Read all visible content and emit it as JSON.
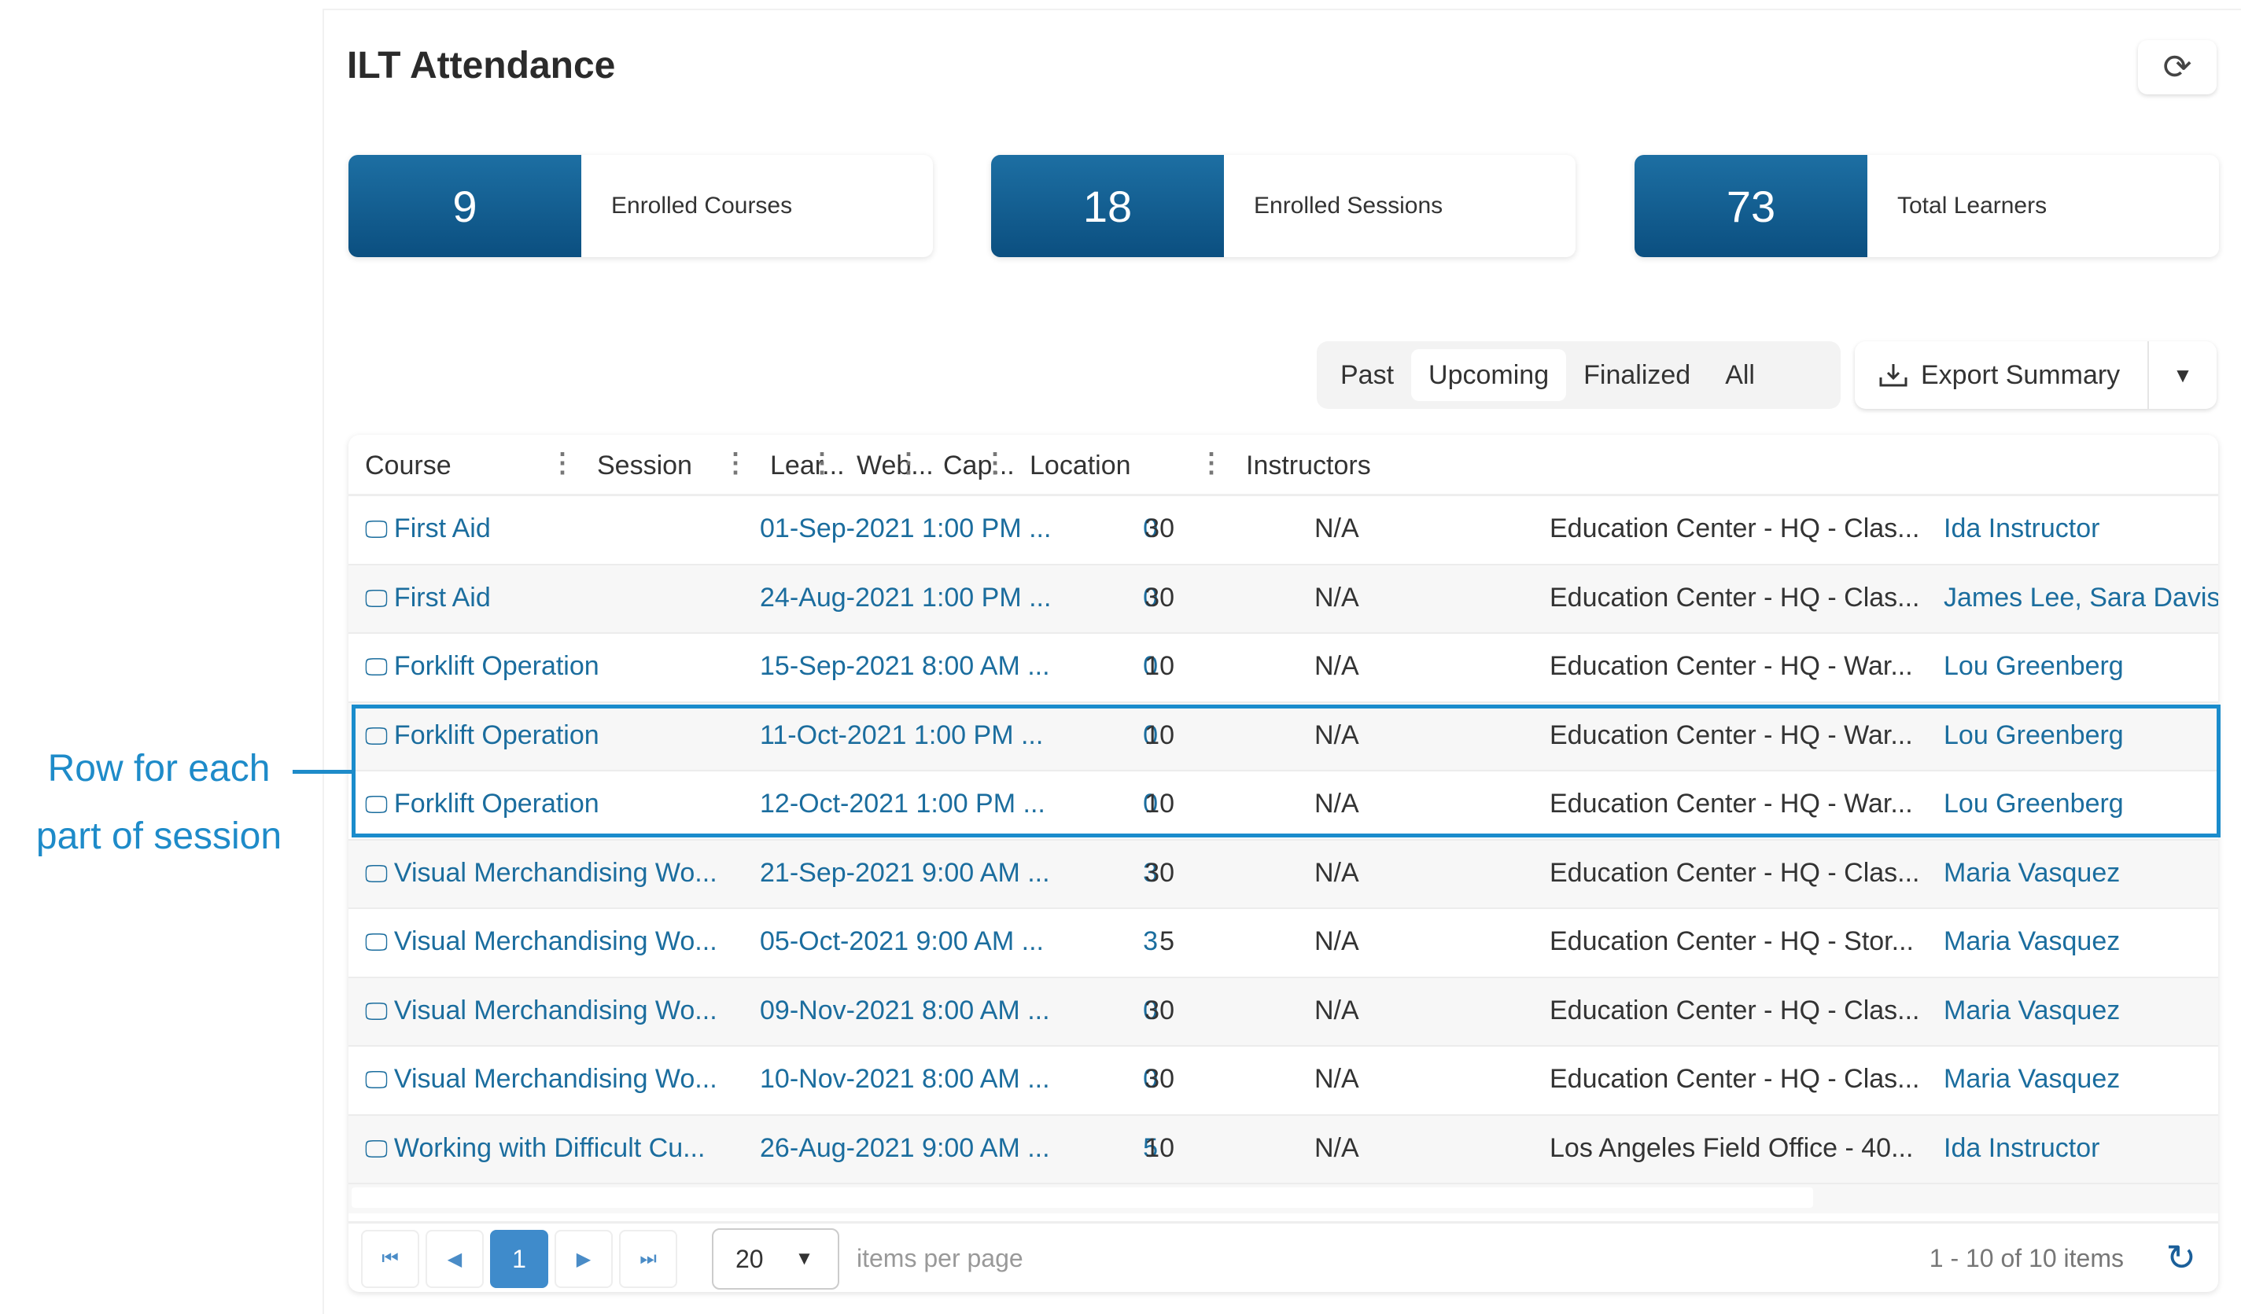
{
  "header": {
    "title": "ILT Attendance"
  },
  "stats": [
    {
      "value": "9",
      "label": "Enrolled Courses"
    },
    {
      "value": "18",
      "label": "Enrolled Sessions"
    },
    {
      "value": "73",
      "label": "Total Learners"
    }
  ],
  "filters": [
    {
      "label": "Past",
      "active": false
    },
    {
      "label": "Upcoming",
      "active": true
    },
    {
      "label": "Finalized",
      "active": false
    },
    {
      "label": "All",
      "active": false
    }
  ],
  "export": {
    "label": "Export Summary"
  },
  "columns": [
    "Course",
    "Session",
    "Lear...",
    "Web...",
    "Cap...",
    "Location",
    "Instructors"
  ],
  "rows": [
    [
      "First Aid",
      "01-Sep-2021 1:00 PM ...",
      "0",
      "N/A",
      "30",
      "Education Center - HQ - Clas...",
      "Ida Instructor"
    ],
    [
      "First Aid",
      "24-Aug-2021 1:00 PM ...",
      "0",
      "N/A",
      "30",
      "Education Center - HQ - Clas...",
      "James Lee, Sara Davis"
    ],
    [
      "Forklift Operation",
      "15-Sep-2021 8:00 AM ...",
      "0",
      "N/A",
      "10",
      "Education Center - HQ - War...",
      "Lou Greenberg"
    ],
    [
      "Forklift Operation",
      "11-Oct-2021 1:00 PM ...",
      "0",
      "N/A",
      "10",
      "Education Center - HQ - War...",
      "Lou Greenberg"
    ],
    [
      "Forklift Operation",
      "12-Oct-2021 1:00 PM ...",
      "0",
      "N/A",
      "10",
      "Education Center - HQ - War...",
      "Lou Greenberg"
    ],
    [
      "Visual Merchandising Wo...",
      "21-Sep-2021 9:00 AM ...",
      "3",
      "N/A",
      "30",
      "Education Center - HQ - Clas...",
      "Maria Vasquez"
    ],
    [
      "Visual Merchandising Wo...",
      "05-Oct-2021 9:00 AM ...",
      "3",
      "N/A",
      "5",
      "Education Center - HQ - Stor...",
      "Maria Vasquez"
    ],
    [
      "Visual Merchandising Wo...",
      "09-Nov-2021 8:00 AM ...",
      "0",
      "N/A",
      "30",
      "Education Center - HQ - Clas...",
      "Maria Vasquez"
    ],
    [
      "Visual Merchandising Wo...",
      "10-Nov-2021 8:00 AM ...",
      "0",
      "N/A",
      "30",
      "Education Center - HQ - Clas...",
      "Maria Vasquez"
    ],
    [
      "Working with Difficult Cu...",
      "26-Aug-2021 9:00 AM ...",
      "5",
      "N/A",
      "10",
      "Los Angeles Field Office - 40...",
      "Ida Instructor"
    ]
  ],
  "pager": {
    "current": "1",
    "page_size": "20",
    "items_per_page_label": "items per page",
    "count": "1 - 10 of 10 items"
  },
  "annotation": {
    "line1": "Row for each",
    "line2": "part of session",
    "color": "#1e8bc9"
  },
  "icons": {
    "course": "classroom-icon",
    "refresh": "refresh-icon",
    "export": "download-icon"
  }
}
